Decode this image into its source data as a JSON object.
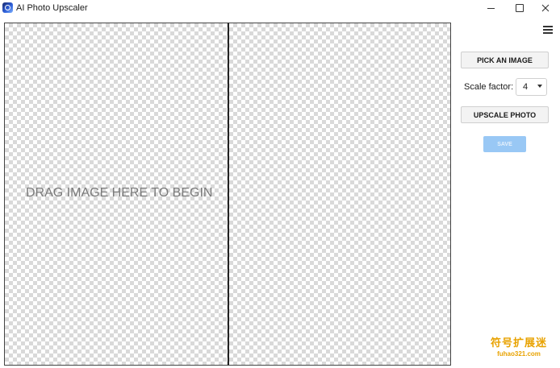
{
  "window": {
    "title": "AI Photo Upscaler",
    "icon": "app-icon",
    "controls": [
      "minimize-icon",
      "maximize-icon",
      "close-icon"
    ]
  },
  "canvas": {
    "drop_hint": "DRAG IMAGE HERE TO BEGIN",
    "panels": [
      "source-panel",
      "result-panel"
    ]
  },
  "sidebar": {
    "menu_icon": "hamburger-menu-icon",
    "pick_label": "PICK AN IMAGE",
    "scale_label": "Scale factor:",
    "scale_value": "4",
    "upscale_label": "UPSCALE PHOTO",
    "save_label": "SAVE"
  },
  "watermark": {
    "line1": "符号扩展迷",
    "line2": "fuhao321.com"
  },
  "colors": {
    "save_button_disabled": "#99c8f5",
    "watermark": "#e8a200",
    "checker": "#d9d9d9"
  }
}
